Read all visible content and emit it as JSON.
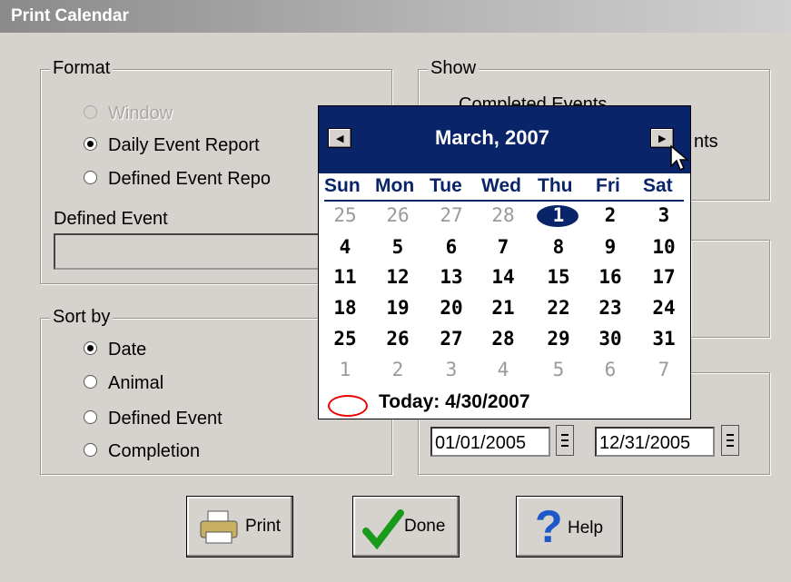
{
  "window": {
    "title": "Print Calendar"
  },
  "format": {
    "legend": "Format",
    "options": [
      "Window",
      "Daily Event Report",
      "Defined Event Repo"
    ],
    "selected": "Daily Event Report",
    "defined_event_label": "Defined Event",
    "defined_event_value": ""
  },
  "show": {
    "legend": "Show",
    "options": [
      "Completed Events",
      "nts"
    ]
  },
  "sort": {
    "legend": "Sort by",
    "options": [
      "Date",
      "Animal",
      "Defined Event",
      "Completion"
    ],
    "selected": "Date"
  },
  "dates": {
    "start": "01/01/2005",
    "end": "12/31/2005"
  },
  "buttons": {
    "print": "Print",
    "done": "Done",
    "help": "Help"
  },
  "calendar": {
    "month_label": "March, 2007",
    "weekdays": [
      "Sun",
      "Mon",
      "Tue",
      "Wed",
      "Thu",
      "Fri",
      "Sat"
    ],
    "weeks": [
      [
        "25",
        "26",
        "27",
        "28",
        "1",
        "2",
        "3"
      ],
      [
        "4",
        "5",
        "6",
        "7",
        "8",
        "9",
        "10"
      ],
      [
        "11",
        "12",
        "13",
        "14",
        "15",
        "16",
        "17"
      ],
      [
        "18",
        "19",
        "20",
        "21",
        "22",
        "23",
        "24"
      ],
      [
        "25",
        "26",
        "27",
        "28",
        "29",
        "30",
        "31"
      ],
      [
        "1",
        "2",
        "3",
        "4",
        "5",
        "6",
        "7"
      ]
    ],
    "selected_day": "1",
    "today_label": "Today: 4/30/2007"
  },
  "colors": {
    "calendar_header": "#0a246a",
    "today_ring": "#e00000"
  }
}
